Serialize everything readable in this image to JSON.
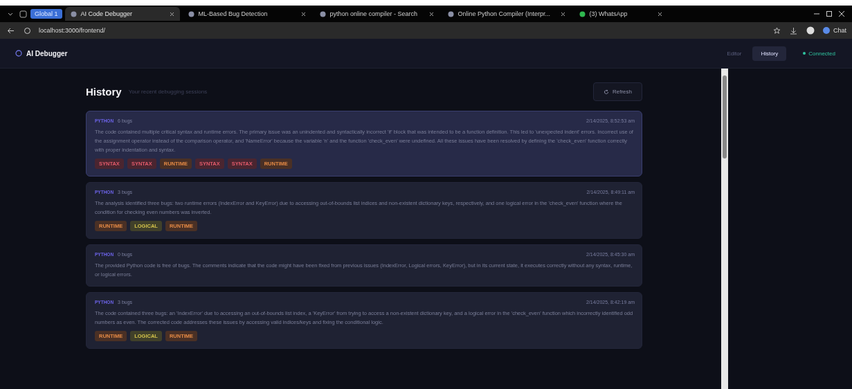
{
  "browser": {
    "workspace": "Global 1",
    "tabs": [
      {
        "title": "AI Code Debugger",
        "selected": true
      },
      {
        "title": "ML-Based Bug Detection",
        "selected": false
      },
      {
        "title": "python online compiler - Search",
        "selected": false
      },
      {
        "title": "Online Python Compiler (Interpr...",
        "selected": false
      },
      {
        "title": "(3) WhatsApp",
        "selected": false
      }
    ],
    "address": "localhost:3000/frontend/",
    "profile_button": "Chat"
  },
  "app": {
    "title": "AI Debugger",
    "nav": [
      {
        "label": "Editor",
        "selected": false
      },
      {
        "label": "History",
        "selected": true
      }
    ],
    "status": {
      "label": "Connected",
      "on": true
    }
  },
  "history": {
    "title": "History",
    "subtitle": "Your recent debugging sessions",
    "refresh": "Refresh",
    "sessions": [
      {
        "language": "PYTHON",
        "count": "6 bugs",
        "time": "2/14/2025, 8:52:53 am",
        "selected": true,
        "summary": "The code contained multiple critical syntax and runtime errors. The primary issue was an unindented and syntactically incorrect 'if' block that was intended to be a function definition. This led to 'unexpected indent' errors. Incorrect use of the assignment operator instead of the comparison operator, and 'NameError' because the variable 'n' and the function 'check_even' were undefined. All these issues have been resolved by defining the 'check_even' function correctly with proper indentation and syntax.",
        "tags": [
          {
            "label": "SYNTAX",
            "kind": "syntax"
          },
          {
            "label": "SYNTAX",
            "kind": "syntax"
          },
          {
            "label": "RUNTIME",
            "kind": "runtime"
          },
          {
            "label": "SYNTAX",
            "kind": "syntax"
          },
          {
            "label": "SYNTAX",
            "kind": "syntax"
          },
          {
            "label": "RUNTIME",
            "kind": "runtime"
          }
        ]
      },
      {
        "language": "PYTHON",
        "count": "3 bugs",
        "time": "2/14/2025, 8:49:11 am",
        "selected": false,
        "summary": "The analysis identified three bugs: two runtime errors (IndexError and KeyError) due to accessing out-of-bounds list indices and non-existent dictionary keys, respectively, and one logical error in the 'check_even' function where the condition for checking even numbers was inverted.",
        "tags": [
          {
            "label": "RUNTIME",
            "kind": "runtime"
          },
          {
            "label": "LOGICAL",
            "kind": "logical"
          },
          {
            "label": "RUNTIME",
            "kind": "runtime"
          }
        ]
      },
      {
        "language": "PYTHON",
        "count": "0 bugs",
        "time": "2/14/2025, 8:45:30 am",
        "selected": false,
        "summary": "The provided Python code is free of bugs. The comments indicate that the code might have been fixed from previous issues (IndexError, Logical errors, KeyError), but in its current state, it executes correctly without any syntax, runtime, or logical errors."
      },
      {
        "language": "PYTHON",
        "count": "3 bugs",
        "time": "2/14/2025, 8:42:19 am",
        "selected": false,
        "summary": "The code contained three bugs: an 'IndexError' due to accessing an out-of-bounds list index, a 'KeyError' from trying to access a non-existent dictionary key, and a logical error in the 'check_even' function which incorrectly identified odd numbers as even. The corrected code addresses these issues by accessing valid indices/keys and fixing the conditional logic.",
        "tags": [
          {
            "label": "RUNTIME",
            "kind": "runtime"
          },
          {
            "label": "LOGICAL",
            "kind": "logical"
          },
          {
            "label": "RUNTIME",
            "kind": "runtime"
          }
        ]
      }
    ]
  }
}
